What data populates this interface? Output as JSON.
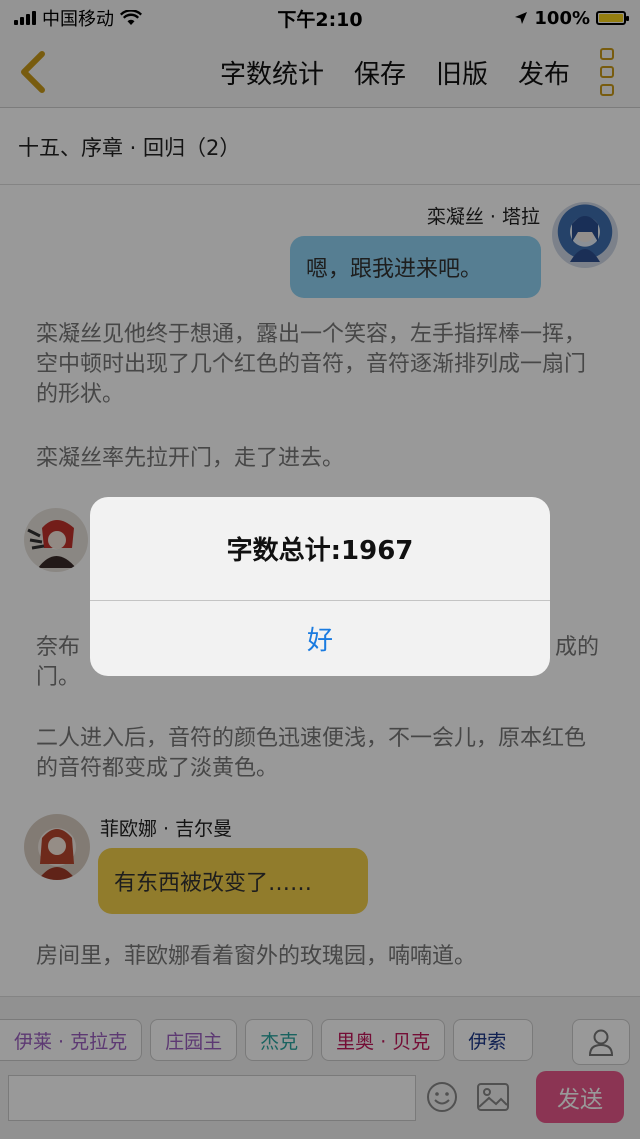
{
  "status_bar": {
    "carrier": "中国移动",
    "time": "下午2:10",
    "battery": "100%",
    "battery_level": 1.0
  },
  "nav": {
    "back_icon": "chevron-left-icon",
    "actions": [
      "字数统计",
      "保存",
      "旧版",
      "发布"
    ],
    "more_icon": "more-vertical-icon"
  },
  "chapter": {
    "title": "十五、序章 · 回归（2）"
  },
  "content": {
    "msg1": {
      "speaker": "栾凝丝 · 塔拉",
      "text": "嗯，跟我进来吧。",
      "bubble_color": "#8fd3f4"
    },
    "para1": "栾凝丝见他终于想通，露出一个笑容，左手指挥棒一挥，空中顿时出现了几个红色的音符，音符逐渐排列成一扇门的形状。",
    "para2": "栾凝丝率先拉开门，走了进去。",
    "para3_start": "奈布",
    "para3_end": "成的",
    "para3_line2": "门。",
    "para4": "二人进入后，音符的颜色迅速便浅，不一会儿，原本红色的音符都变成了淡黄色。",
    "msg2": {
      "speaker": "菲欧娜 · 吉尔曼",
      "text": "有东西被改变了……",
      "bubble_color": "#f2cf4a"
    },
    "para5": "房间里，菲欧娜看着窗外的玫瑰园，喃喃道。"
  },
  "bottom": {
    "chips": [
      {
        "label": "伊莱 · 克拉克",
        "color": "#9b5fc0"
      },
      {
        "label": "庄园主",
        "color": "#9b5fc0"
      },
      {
        "label": "杰克",
        "color": "#2aa6a0"
      },
      {
        "label": "里奥 · 贝克",
        "color": "#c2185b"
      },
      {
        "label": "伊索",
        "color": "#1e3a8a"
      }
    ],
    "input_value": "",
    "send_label": "发送"
  },
  "alert": {
    "message": "字数总计:1967",
    "button": "好"
  }
}
